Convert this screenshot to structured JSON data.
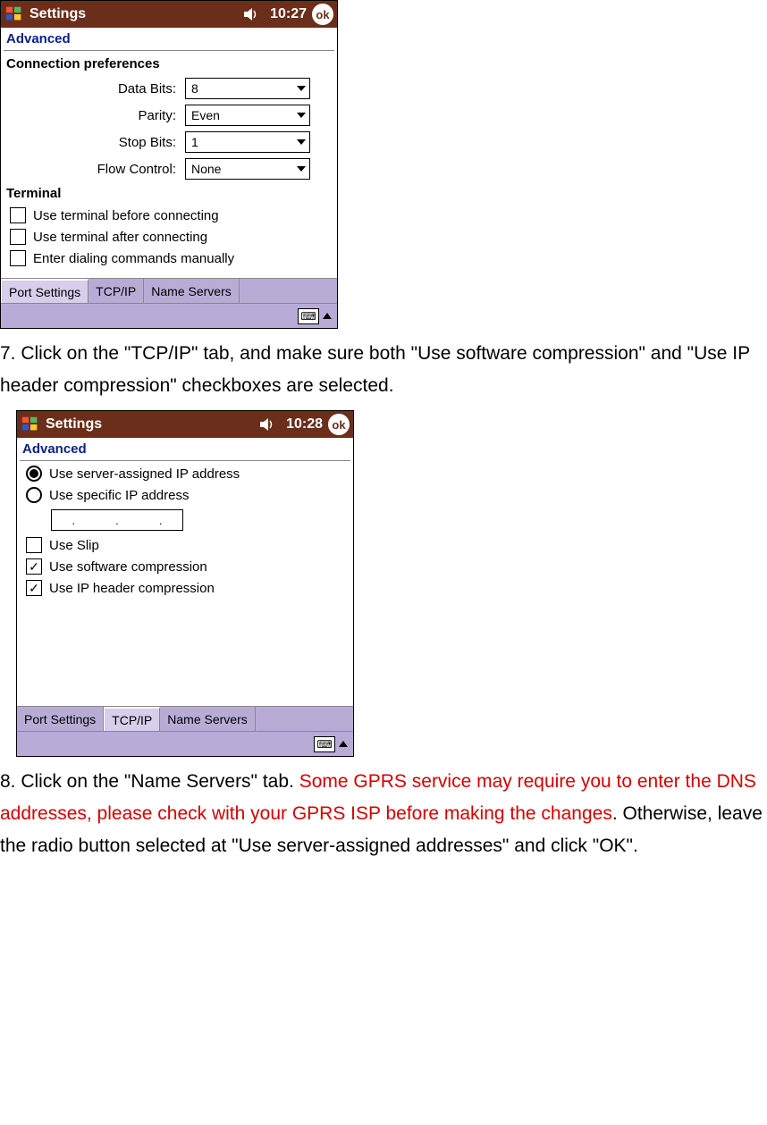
{
  "screenshot1": {
    "titlebar": {
      "app": "Settings",
      "time": "10:27",
      "ok": "ok"
    },
    "section_label": "Advanced",
    "conn_pref_heading": "Connection preferences",
    "fields": {
      "data_bits": {
        "label": "Data Bits:",
        "value": "8"
      },
      "parity": {
        "label": "Parity:",
        "value": "Even"
      },
      "stop_bits": {
        "label": "Stop Bits:",
        "value": "1"
      },
      "flow_control": {
        "label": "Flow Control:",
        "value": "None"
      }
    },
    "terminal_heading": "Terminal",
    "terminal_opts": {
      "before": "Use terminal before connecting",
      "after": "Use terminal after connecting",
      "manual": "Enter dialing commands manually"
    },
    "tabs": {
      "port": "Port Settings",
      "tcpip": "TCP/IP",
      "ns": "Name Servers"
    }
  },
  "step7": {
    "prefix": "7. Click on the \"TCP/IP\" tab, and make sure both \"Use software compression\" and \"Use IP header compression\" checkboxes are selected."
  },
  "screenshot2": {
    "titlebar": {
      "app": "Settings",
      "time": "10:28",
      "ok": "ok"
    },
    "section_label": "Advanced",
    "radios": {
      "server_ip": "Use server-assigned IP address",
      "specific_ip": "Use specific IP address"
    },
    "ip_dots": ". . .",
    "checks": {
      "slip": "Use Slip",
      "swcomp": "Use software compression",
      "iphdr": "Use IP header compression"
    },
    "tabs": {
      "port": "Port Settings",
      "tcpip": "TCP/IP",
      "ns": "Name Servers"
    }
  },
  "step8": {
    "part1": "8. Click on the \"Name Servers\" tab. ",
    "red": "Some GPRS service may require you to enter the DNS addresses, please check with your GPRS ISP before making the changes",
    "part2": ". Otherwise, leave the radio button selected at \"Use server-assigned addresses\" and click \"OK\"."
  }
}
